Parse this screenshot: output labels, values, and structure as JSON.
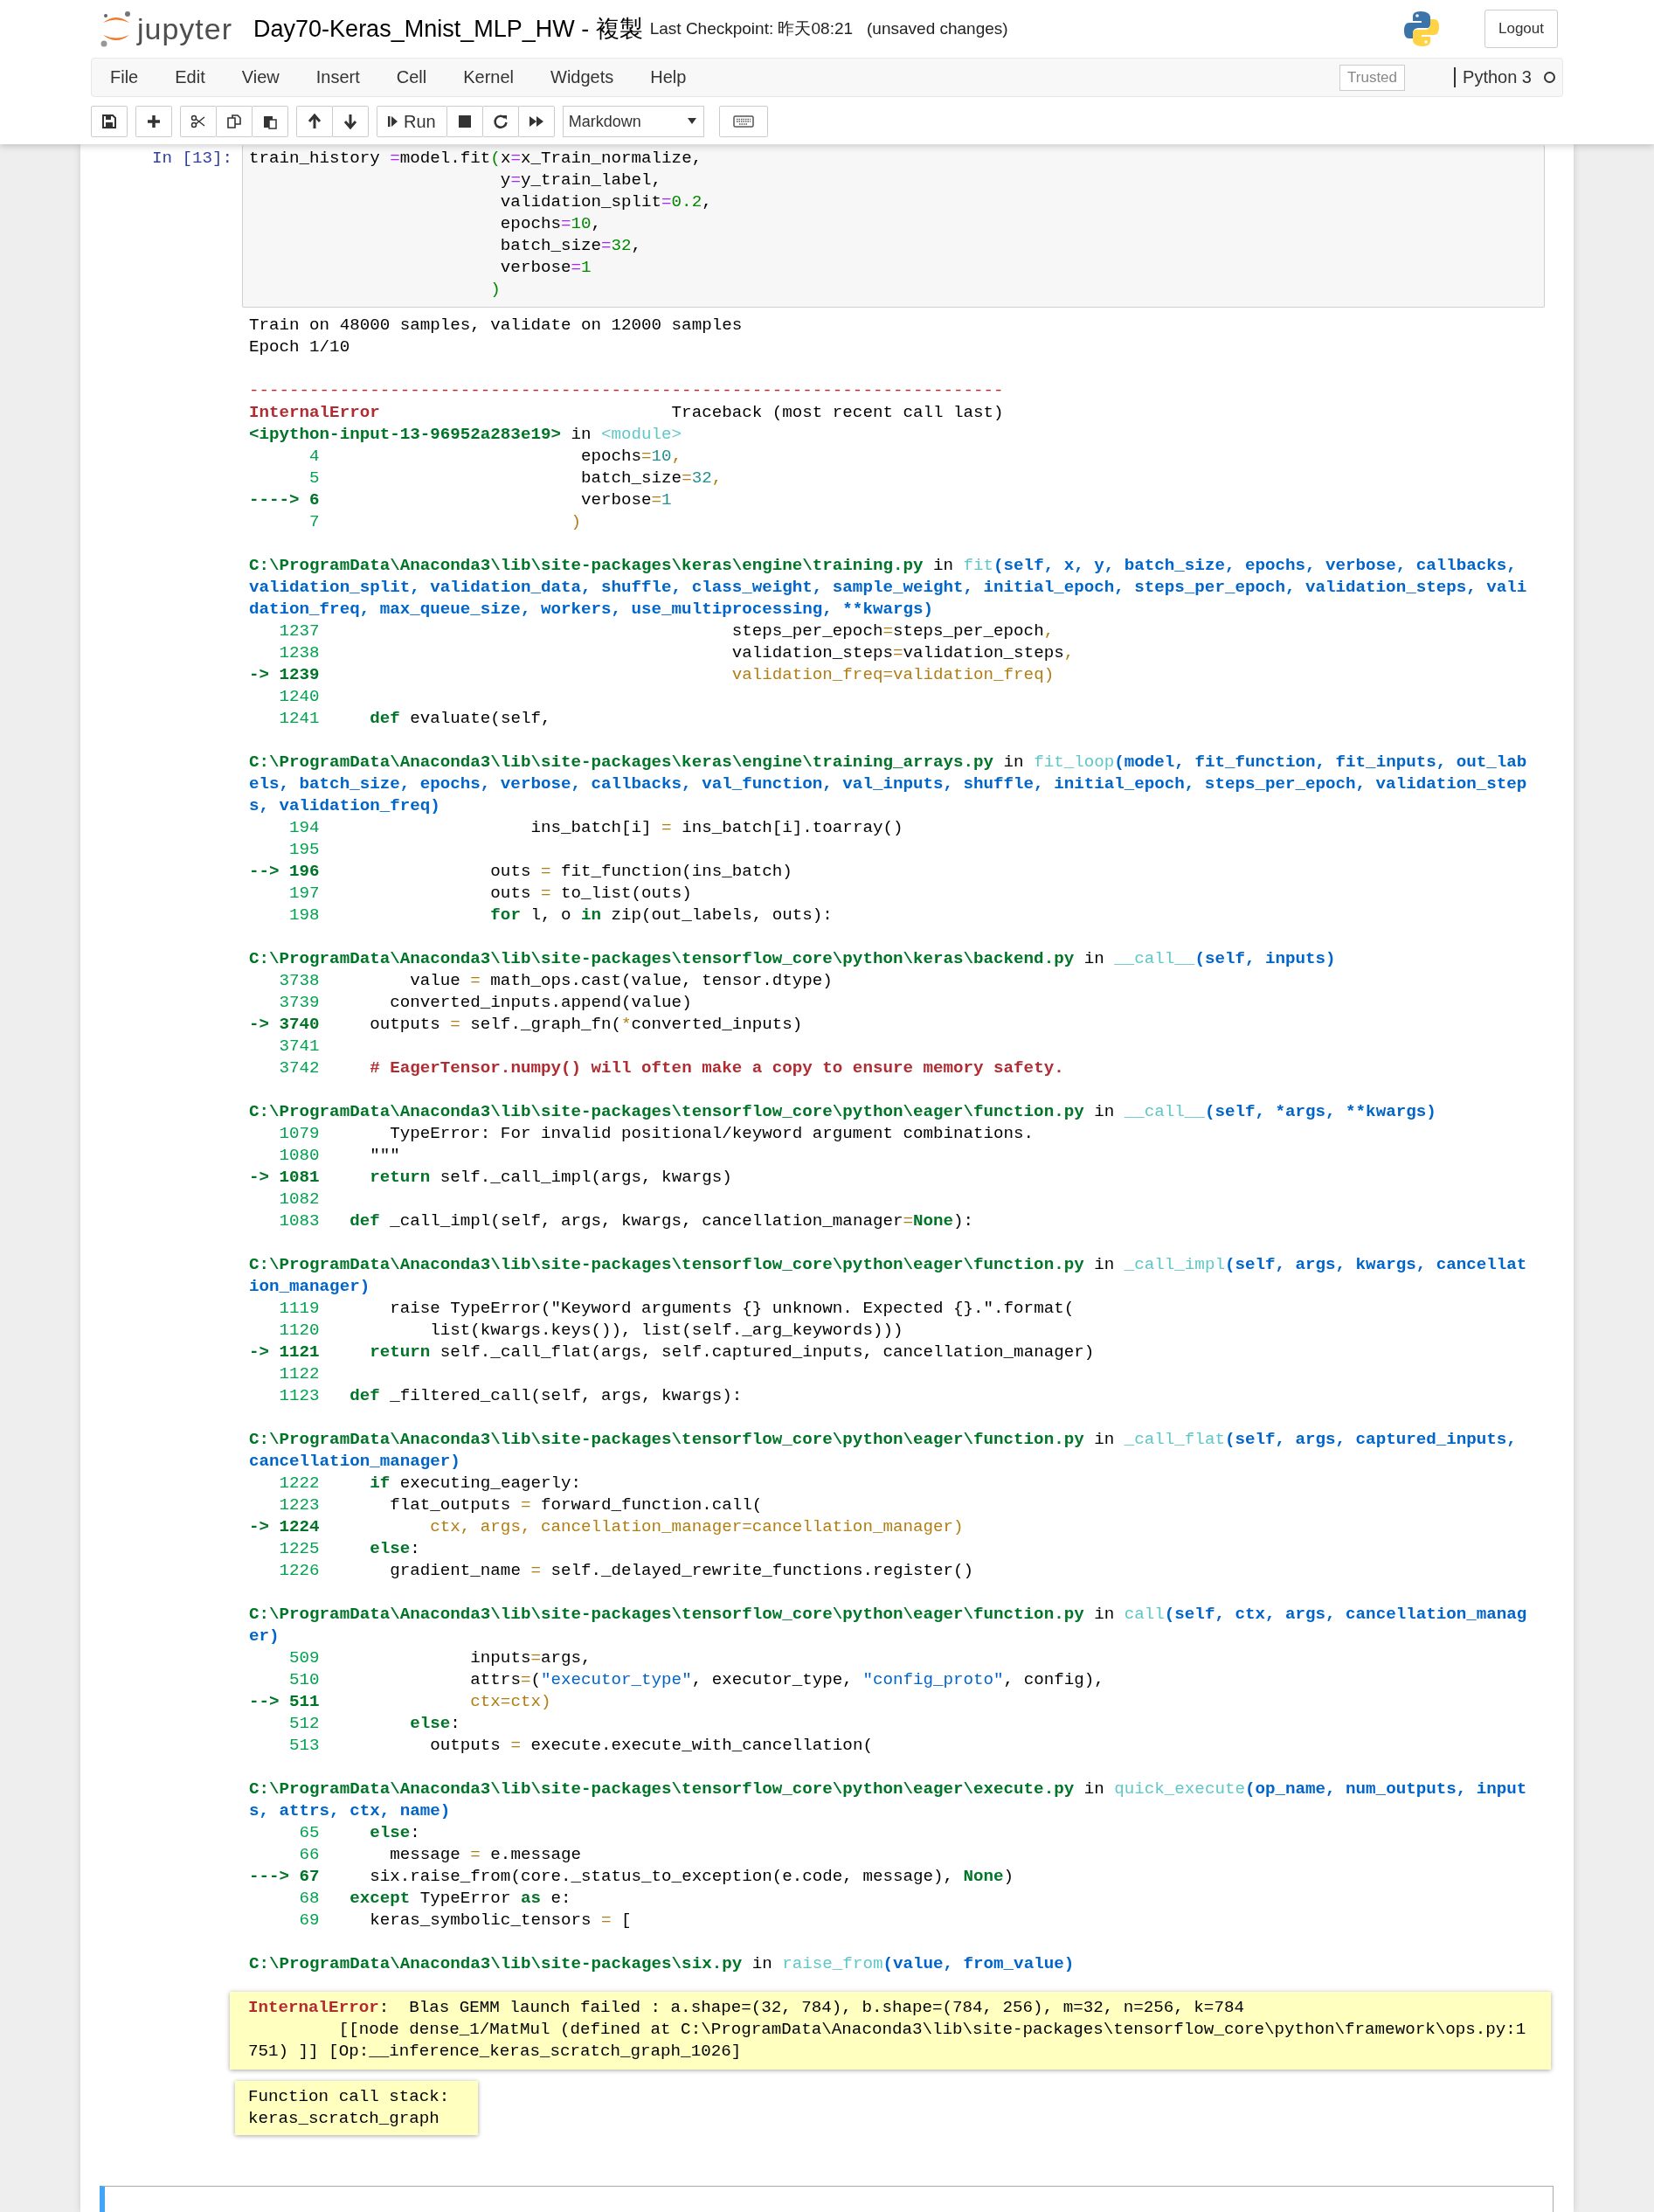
{
  "header": {
    "logo": "jupyter",
    "notebook_name": "Day70-Keras_Mnist_MLP_HW - 複製",
    "checkpoint": "Last Checkpoint: 昨天08:21",
    "autosave": "(unsaved changes)",
    "logout": "Logout"
  },
  "menu": [
    "File",
    "Edit",
    "View",
    "Insert",
    "Cell",
    "Kernel",
    "Widgets",
    "Help"
  ],
  "trusted": "Trusted",
  "kernel": {
    "name": "Python 3",
    "busy": false
  },
  "toolbar": {
    "run": "Run",
    "cell_type": "Markdown"
  },
  "cell": {
    "prompt": "In [13]:",
    "code": [
      [
        {
          "kind": "p",
          "text": "train_history "
        },
        {
          "kind": "op",
          "text": "="
        },
        {
          "kind": "p",
          "text": "model.fit"
        },
        {
          "kind": "num",
          "text": "("
        },
        {
          "kind": "p",
          "text": "x"
        },
        {
          "kind": "op",
          "text": "="
        },
        {
          "kind": "p",
          "text": "x_Train_normalize,"
        }
      ],
      [
        {
          "kind": "p",
          "text": "                         y"
        },
        {
          "kind": "op",
          "text": "="
        },
        {
          "kind": "p",
          "text": "y_train_label,"
        }
      ],
      [
        {
          "kind": "p",
          "text": "                         validation_split"
        },
        {
          "kind": "op",
          "text": "="
        },
        {
          "kind": "num",
          "text": "0.2"
        },
        {
          "kind": "p",
          "text": ","
        }
      ],
      [
        {
          "kind": "p",
          "text": "                         epochs"
        },
        {
          "kind": "op",
          "text": "="
        },
        {
          "kind": "num",
          "text": "10"
        },
        {
          "kind": "p",
          "text": ","
        }
      ],
      [
        {
          "kind": "p",
          "text": "                         batch_size"
        },
        {
          "kind": "op",
          "text": "="
        },
        {
          "kind": "num",
          "text": "32"
        },
        {
          "kind": "p",
          "text": ","
        }
      ],
      [
        {
          "kind": "p",
          "text": "                         verbose"
        },
        {
          "kind": "op",
          "text": "="
        },
        {
          "kind": "num",
          "text": "1"
        }
      ],
      [
        {
          "kind": "num",
          "text": "                        )"
        }
      ]
    ],
    "output": [
      [
        [
          {
            "kind": "p",
            "text": "Train on 48000 samples, validate on 12000 samples"
          }
        ],
        [
          {
            "kind": "p",
            "text": "Epoch 1/10"
          }
        ]
      ],
      [
        [
          {
            "kind": "dash",
            "text": "---------------------------------------------------------------------------"
          }
        ],
        [
          {
            "kind": "err",
            "text": "InternalError"
          },
          {
            "kind": "p",
            "text": "                             Traceback (most recent call last)"
          }
        ],
        [
          {
            "kind": "path",
            "text": "<ipython-input-13-96952a283e19>"
          },
          {
            "kind": "p",
            "text": " in "
          },
          {
            "kind": "fn",
            "text": "<module>"
          }
        ],
        [
          {
            "kind": "ln",
            "text": "      4"
          },
          {
            "kind": "p",
            "text": "                          epochs"
          },
          {
            "kind": "yel",
            "text": "="
          },
          {
            "kind": "teal",
            "text": "10"
          },
          {
            "kind": "yel",
            "text": ","
          }
        ],
        [
          {
            "kind": "ln",
            "text": "      5"
          },
          {
            "kind": "p",
            "text": "                          batch_size"
          },
          {
            "kind": "yel",
            "text": "="
          },
          {
            "kind": "teal",
            "text": "32"
          },
          {
            "kind": "yel",
            "text": ","
          }
        ],
        [
          {
            "kind": "arrow",
            "text": "----> 6"
          },
          {
            "kind": "p",
            "text": "                          verbose"
          },
          {
            "kind": "yel",
            "text": "="
          },
          {
            "kind": "teal",
            "text": "1"
          }
        ],
        [
          {
            "kind": "ln",
            "text": "      7"
          },
          {
            "kind": "yel",
            "text": "                         )"
          }
        ]
      ],
      [
        [
          {
            "kind": "path",
            "text": "C:\\ProgramData\\Anaconda3\\lib\\site-packages\\keras\\engine\\training.py"
          },
          {
            "kind": "p",
            "text": " in "
          },
          {
            "kind": "fn",
            "text": "fit"
          },
          {
            "kind": "args",
            "text": "(self, x, y, batch_size, epochs, verbose, callbacks,"
          }
        ],
        [
          {
            "kind": "args",
            "text": "validation_split, validation_data, shuffle, class_weight, sample_weight, initial_epoch, steps_per_epoch, validation_steps, vali"
          }
        ],
        [
          {
            "kind": "args",
            "text": "dation_freq, max_queue_size, workers, use_multiprocessing, **kwargs)"
          }
        ],
        [
          {
            "kind": "ln",
            "text": "   1237"
          },
          {
            "kind": "p",
            "text": "                                         steps_per_epoch"
          },
          {
            "kind": "yel",
            "text": "="
          },
          {
            "kind": "p",
            "text": "steps_per_epoch"
          },
          {
            "kind": "yel",
            "text": ","
          }
        ],
        [
          {
            "kind": "ln",
            "text": "   1238"
          },
          {
            "kind": "p",
            "text": "                                         validation_steps"
          },
          {
            "kind": "yel",
            "text": "="
          },
          {
            "kind": "p",
            "text": "validation_steps"
          },
          {
            "kind": "yel",
            "text": ","
          }
        ],
        [
          {
            "kind": "arrow",
            "text": "-> 1239"
          },
          {
            "kind": "yel",
            "text": "                                         validation_freq=validation_freq)"
          }
        ],
        [
          {
            "kind": "ln",
            "text": "   1240"
          }
        ],
        [
          {
            "kind": "ln",
            "text": "   1241"
          },
          {
            "kind": "kw",
            "text": "     def"
          },
          {
            "kind": "p",
            "text": " evaluate(self,"
          }
        ]
      ],
      [
        [
          {
            "kind": "path",
            "text": "C:\\ProgramData\\Anaconda3\\lib\\site-packages\\keras\\engine\\training_arrays.py"
          },
          {
            "kind": "p",
            "text": " in "
          },
          {
            "kind": "fn",
            "text": "fit_loop"
          },
          {
            "kind": "args",
            "text": "(model, fit_function, fit_inputs, out_lab"
          }
        ],
        [
          {
            "kind": "args",
            "text": "els, batch_size, epochs, verbose, callbacks, val_function, val_inputs, shuffle, initial_epoch, steps_per_epoch, validation_step"
          }
        ],
        [
          {
            "kind": "args",
            "text": "s, validation_freq)"
          }
        ],
        [
          {
            "kind": "ln",
            "text": "    194"
          },
          {
            "kind": "p",
            "text": "                     ins_batch[i] "
          },
          {
            "kind": "yel",
            "text": "="
          },
          {
            "kind": "p",
            "text": " ins_batch[i].toarray()"
          }
        ],
        [
          {
            "kind": "ln",
            "text": "    195"
          }
        ],
        [
          {
            "kind": "arrow",
            "text": "--> 196"
          },
          {
            "kind": "p",
            "text": "                 outs "
          },
          {
            "kind": "yel",
            "text": "="
          },
          {
            "kind": "p",
            "text": " fit_function(ins_batch)"
          }
        ],
        [
          {
            "kind": "ln",
            "text": "    197"
          },
          {
            "kind": "p",
            "text": "                 outs "
          },
          {
            "kind": "yel",
            "text": "="
          },
          {
            "kind": "p",
            "text": " to_list(outs)"
          }
        ],
        [
          {
            "kind": "ln",
            "text": "    198"
          },
          {
            "kind": "kw",
            "text": "                 for"
          },
          {
            "kind": "p",
            "text": " l, o "
          },
          {
            "kind": "kw",
            "text": "in"
          },
          {
            "kind": "p",
            "text": " zip(out_labels, outs):"
          }
        ]
      ],
      [
        [
          {
            "kind": "path",
            "text": "C:\\ProgramData\\Anaconda3\\lib\\site-packages\\tensorflow_core\\python\\keras\\backend.py"
          },
          {
            "kind": "p",
            "text": " in "
          },
          {
            "kind": "fn",
            "text": "__call__"
          },
          {
            "kind": "args",
            "text": "(self, inputs)"
          }
        ],
        [
          {
            "kind": "ln",
            "text": "   3738"
          },
          {
            "kind": "p",
            "text": "         value "
          },
          {
            "kind": "yel",
            "text": "="
          },
          {
            "kind": "p",
            "text": " math_ops.cast(value, tensor.dtype)"
          }
        ],
        [
          {
            "kind": "ln",
            "text": "   3739"
          },
          {
            "kind": "p",
            "text": "       converted_inputs.append(value)"
          }
        ],
        [
          {
            "kind": "arrow",
            "text": "-> 3740"
          },
          {
            "kind": "p",
            "text": "     outputs "
          },
          {
            "kind": "yel",
            "text": "="
          },
          {
            "kind": "p",
            "text": " self._graph_fn("
          },
          {
            "kind": "yel",
            "text": "*"
          },
          {
            "kind": "p",
            "text": "converted_inputs)"
          }
        ],
        [
          {
            "kind": "ln",
            "text": "   3741"
          }
        ],
        [
          {
            "kind": "ln",
            "text": "   3742"
          },
          {
            "kind": "cmt",
            "text": "     # EagerTensor.numpy() will often make a copy to ensure memory safety."
          }
        ]
      ],
      [
        [
          {
            "kind": "path",
            "text": "C:\\ProgramData\\Anaconda3\\lib\\site-packages\\tensorflow_core\\python\\eager\\function.py"
          },
          {
            "kind": "p",
            "text": " in "
          },
          {
            "kind": "fn",
            "text": "__call__"
          },
          {
            "kind": "args",
            "text": "(self, *args, **kwargs)"
          }
        ],
        [
          {
            "kind": "ln",
            "text": "   1079"
          },
          {
            "kind": "p",
            "text": "       TypeError: For invalid positional/keyword argument combinations."
          }
        ],
        [
          {
            "kind": "ln",
            "text": "   1080"
          },
          {
            "kind": "p",
            "text": "     \"\"\""
          }
        ],
        [
          {
            "kind": "arrow",
            "text": "-> 1081"
          },
          {
            "kind": "kw",
            "text": "     return"
          },
          {
            "kind": "p",
            "text": " self._call_impl(args, kwargs)"
          }
        ],
        [
          {
            "kind": "ln",
            "text": "   1082"
          }
        ],
        [
          {
            "kind": "ln",
            "text": "   1083"
          },
          {
            "kind": "kw",
            "text": "   def"
          },
          {
            "kind": "p",
            "text": " _call_impl(self, args, kwargs, cancellation_manager"
          },
          {
            "kind": "yel",
            "text": "="
          },
          {
            "kind": "kw",
            "text": "None"
          },
          {
            "kind": "p",
            "text": "):"
          }
        ]
      ],
      [
        [
          {
            "kind": "path",
            "text": "C:\\ProgramData\\Anaconda3\\lib\\site-packages\\tensorflow_core\\python\\eager\\function.py"
          },
          {
            "kind": "p",
            "text": " in "
          },
          {
            "kind": "fn",
            "text": "_call_impl"
          },
          {
            "kind": "args",
            "text": "(self, args, kwargs, cancellat"
          }
        ],
        [
          {
            "kind": "args",
            "text": "ion_manager)"
          }
        ],
        [
          {
            "kind": "ln",
            "text": "   1119"
          },
          {
            "kind": "p",
            "text": "       raise TypeError(\"Keyword arguments {} unknown. Expected {}.\".format("
          }
        ],
        [
          {
            "kind": "ln",
            "text": "   1120"
          },
          {
            "kind": "p",
            "text": "           list(kwargs.keys()), list(self._arg_keywords)))"
          }
        ],
        [
          {
            "kind": "arrow",
            "text": "-> 1121"
          },
          {
            "kind": "kw",
            "text": "     return"
          },
          {
            "kind": "p",
            "text": " self._call_flat(args, self.captured_inputs, cancellation_manager)"
          }
        ],
        [
          {
            "kind": "ln",
            "text": "   1122"
          }
        ],
        [
          {
            "kind": "ln",
            "text": "   1123"
          },
          {
            "kind": "kw",
            "text": "   def"
          },
          {
            "kind": "p",
            "text": " _filtered_call(self, args, kwargs):"
          }
        ]
      ],
      [
        [
          {
            "kind": "path",
            "text": "C:\\ProgramData\\Anaconda3\\lib\\site-packages\\tensorflow_core\\python\\eager\\function.py"
          },
          {
            "kind": "p",
            "text": " in "
          },
          {
            "kind": "fn",
            "text": "_call_flat"
          },
          {
            "kind": "args",
            "text": "(self, args, captured_inputs,"
          }
        ],
        [
          {
            "kind": "args",
            "text": "cancellation_manager)"
          }
        ],
        [
          {
            "kind": "ln",
            "text": "   1222"
          },
          {
            "kind": "kw",
            "text": "     if"
          },
          {
            "kind": "p",
            "text": " executing_eagerly:"
          }
        ],
        [
          {
            "kind": "ln",
            "text": "   1223"
          },
          {
            "kind": "p",
            "text": "       flat_outputs "
          },
          {
            "kind": "yel",
            "text": "="
          },
          {
            "kind": "p",
            "text": " forward_function.call("
          }
        ],
        [
          {
            "kind": "arrow",
            "text": "-> 1224"
          },
          {
            "kind": "yel",
            "text": "           ctx, args, cancellation_manager=cancellation_manager)"
          }
        ],
        [
          {
            "kind": "ln",
            "text": "   1225"
          },
          {
            "kind": "kw",
            "text": "     else"
          },
          {
            "kind": "p",
            "text": ":"
          }
        ],
        [
          {
            "kind": "ln",
            "text": "   1226"
          },
          {
            "kind": "p",
            "text": "       gradient_name "
          },
          {
            "kind": "yel",
            "text": "="
          },
          {
            "kind": "p",
            "text": " self._delayed_rewrite_functions.register()"
          }
        ]
      ],
      [
        [
          {
            "kind": "path",
            "text": "C:\\ProgramData\\Anaconda3\\lib\\site-packages\\tensorflow_core\\python\\eager\\function.py"
          },
          {
            "kind": "p",
            "text": " in "
          },
          {
            "kind": "fn",
            "text": "call"
          },
          {
            "kind": "args",
            "text": "(self, ctx, args, cancellation_manag"
          }
        ],
        [
          {
            "kind": "args",
            "text": "er)"
          }
        ],
        [
          {
            "kind": "ln",
            "text": "    509"
          },
          {
            "kind": "p",
            "text": "               inputs"
          },
          {
            "kind": "yel",
            "text": "="
          },
          {
            "kind": "p",
            "text": "args,"
          }
        ],
        [
          {
            "kind": "ln",
            "text": "    510"
          },
          {
            "kind": "p",
            "text": "               attrs"
          },
          {
            "kind": "yel",
            "text": "="
          },
          {
            "kind": "p",
            "text": "("
          },
          {
            "kind": "str",
            "text": "\"executor_type\""
          },
          {
            "kind": "p",
            "text": ", executor_type, "
          },
          {
            "kind": "str",
            "text": "\"config_proto\""
          },
          {
            "kind": "p",
            "text": ", config),"
          }
        ],
        [
          {
            "kind": "arrow",
            "text": "--> 511"
          },
          {
            "kind": "yel",
            "text": "               ctx=ctx)"
          }
        ],
        [
          {
            "kind": "ln",
            "text": "    512"
          },
          {
            "kind": "kw",
            "text": "         else"
          },
          {
            "kind": "p",
            "text": ":"
          }
        ],
        [
          {
            "kind": "ln",
            "text": "    513"
          },
          {
            "kind": "p",
            "text": "           outputs "
          },
          {
            "kind": "yel",
            "text": "="
          },
          {
            "kind": "p",
            "text": " execute.execute_with_cancellation("
          }
        ]
      ],
      [
        [
          {
            "kind": "path",
            "text": "C:\\ProgramData\\Anaconda3\\lib\\site-packages\\tensorflow_core\\python\\eager\\execute.py"
          },
          {
            "kind": "p",
            "text": " in "
          },
          {
            "kind": "fn",
            "text": "quick_execute"
          },
          {
            "kind": "args",
            "text": "(op_name, num_outputs, input"
          }
        ],
        [
          {
            "kind": "args",
            "text": "s, attrs, ctx, name)"
          }
        ],
        [
          {
            "kind": "ln",
            "text": "     65"
          },
          {
            "kind": "kw",
            "text": "     else"
          },
          {
            "kind": "p",
            "text": ":"
          }
        ],
        [
          {
            "kind": "ln",
            "text": "     66"
          },
          {
            "kind": "p",
            "text": "       message "
          },
          {
            "kind": "yel",
            "text": "="
          },
          {
            "kind": "p",
            "text": " e.message"
          }
        ],
        [
          {
            "kind": "arrow",
            "text": "---> 67"
          },
          {
            "kind": "p",
            "text": "     six.raise_from(core._status_to_exception(e.code, message), "
          },
          {
            "kind": "kw",
            "text": "None"
          },
          {
            "kind": "p",
            "text": ")"
          }
        ],
        [
          {
            "kind": "ln",
            "text": "     68"
          },
          {
            "kind": "kw",
            "text": "   except"
          },
          {
            "kind": "p",
            "text": " TypeError "
          },
          {
            "kind": "kw",
            "text": "as"
          },
          {
            "kind": "p",
            "text": " e:"
          }
        ],
        [
          {
            "kind": "ln",
            "text": "     69"
          },
          {
            "kind": "p",
            "text": "     keras_symbolic_tensors "
          },
          {
            "kind": "yel",
            "text": "="
          },
          {
            "kind": "p",
            "text": " ["
          }
        ]
      ],
      [
        [
          {
            "kind": "path",
            "text": "C:\\ProgramData\\Anaconda3\\lib\\site-packages\\six.py"
          },
          {
            "kind": "p",
            "text": " in "
          },
          {
            "kind": "fn",
            "text": "raise_from"
          },
          {
            "kind": "args",
            "text": "(value, from_value)"
          }
        ]
      ]
    ],
    "error": [
      [
        {
          "kind": "err",
          "text": "InternalError"
        },
        {
          "kind": "p",
          "text": ":  Blas GEMM launch failed : a.shape=(32, 784), b.shape=(784, 256), m=32, n=256, k=784"
        }
      ],
      [
        {
          "kind": "p",
          "text": "         [[node dense_1/MatMul (defined at C:\\ProgramData\\Anaconda3\\lib\\site-packages\\tensorflow_core\\python\\framework\\ops.py:1"
        }
      ],
      [
        {
          "kind": "p",
          "text": "751) ]] [Op:__inference_keras_scratch_graph_1026]"
        }
      ]
    ],
    "call_stack": [
      "Function call stack:",
      "keras_scratch_graph"
    ]
  }
}
